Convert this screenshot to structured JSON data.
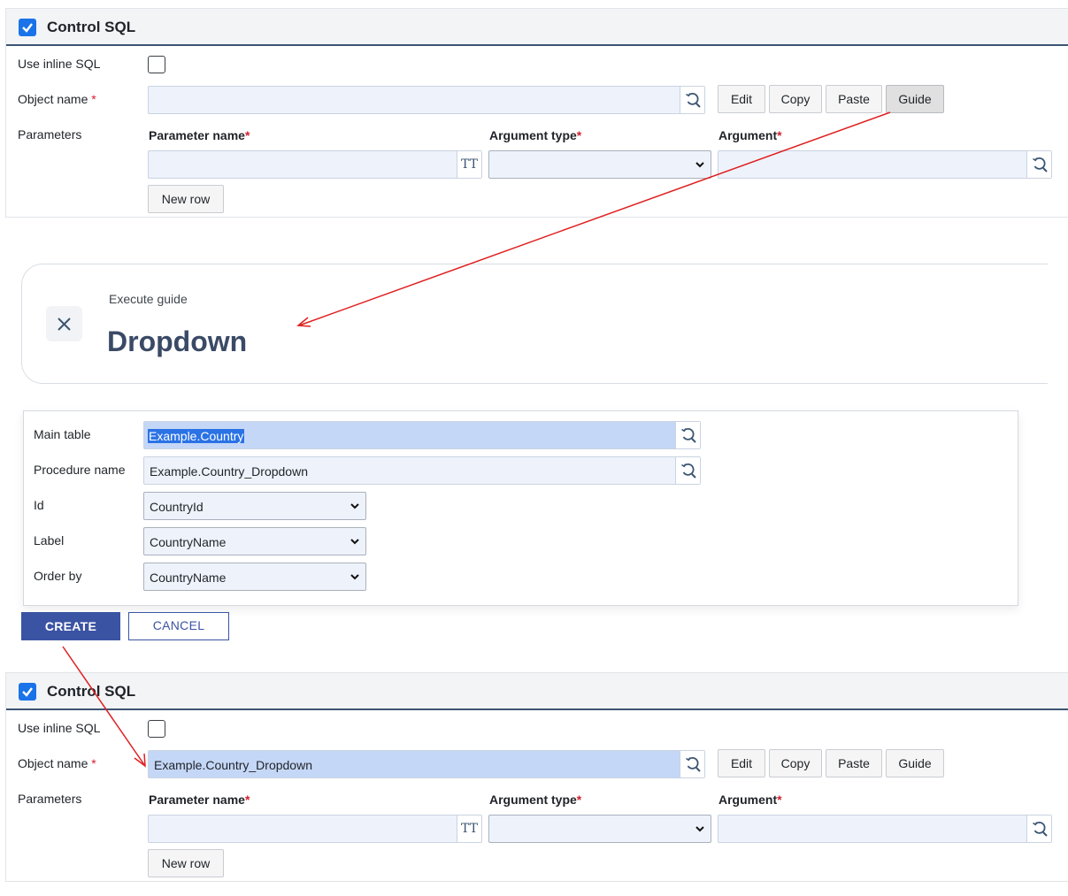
{
  "top_panel": {
    "title": "Control SQL",
    "use_inline_sql_label": "Use inline SQL",
    "object_name_label": "Object name",
    "required_mark": "*",
    "object_name_value": "",
    "buttons": {
      "edit": "Edit",
      "copy": "Copy",
      "paste": "Paste",
      "guide": "Guide"
    },
    "parameters_label": "Parameters",
    "columns": {
      "parameter_name": "Parameter name",
      "argument_type": "Argument type",
      "argument": "Argument"
    },
    "tt_icon_text": "TT",
    "new_row": "New row"
  },
  "guide": {
    "subtitle": "Execute guide",
    "title": "Dropdown",
    "fields": {
      "main_table_label": "Main table",
      "main_table_value": "Example.Country",
      "procedure_name_label": "Procedure name",
      "procedure_name_value": "Example.Country_Dropdown",
      "id_label": "Id",
      "id_value": "CountryId",
      "label_label": "Label",
      "label_value": "CountryName",
      "order_by_label": "Order by",
      "order_by_value": "CountryName"
    },
    "create": "CREATE",
    "cancel": "CANCEL"
  },
  "bottom_panel": {
    "title": "Control SQL",
    "use_inline_sql_label": "Use inline SQL",
    "object_name_label": "Object name",
    "required_mark": "*",
    "object_name_value": "Example.Country_Dropdown",
    "buttons": {
      "edit": "Edit",
      "copy": "Copy",
      "paste": "Paste",
      "guide": "Guide"
    },
    "parameters_label": "Parameters",
    "columns": {
      "parameter_name": "Parameter name",
      "argument_type": "Argument type",
      "argument": "Argument"
    },
    "tt_icon_text": "TT",
    "new_row": "New row"
  },
  "colors": {
    "accent": "#3b53a3",
    "checkbox": "#1a73e8",
    "arrow": "#e02020",
    "highlight": "#c5d7f7"
  },
  "icons": [
    "checkbox-checked-icon",
    "lookup-icon",
    "text-type-icon",
    "chevron-down-icon",
    "close-icon"
  ]
}
